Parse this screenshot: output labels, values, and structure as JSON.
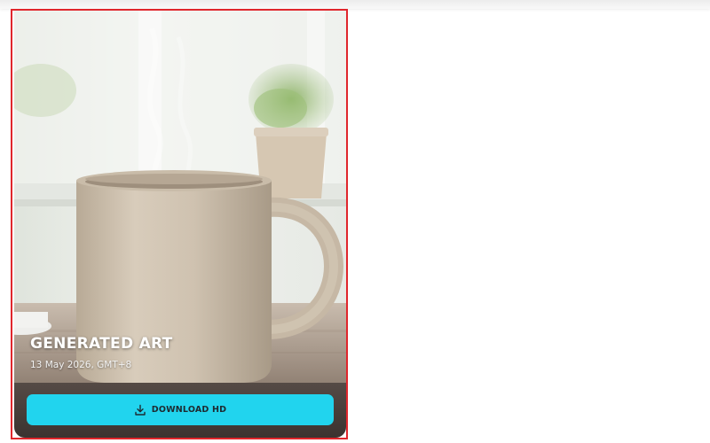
{
  "card": {
    "title": "GENERATED ART",
    "date": "13 May 2026, GMT+8",
    "download_label": "DOWNLOAD HD"
  },
  "icons": {
    "download": "download-icon"
  },
  "colors": {
    "accent": "#21d4ee",
    "selection_border": "#e0262c",
    "bottom_bar": "#4a403c"
  }
}
